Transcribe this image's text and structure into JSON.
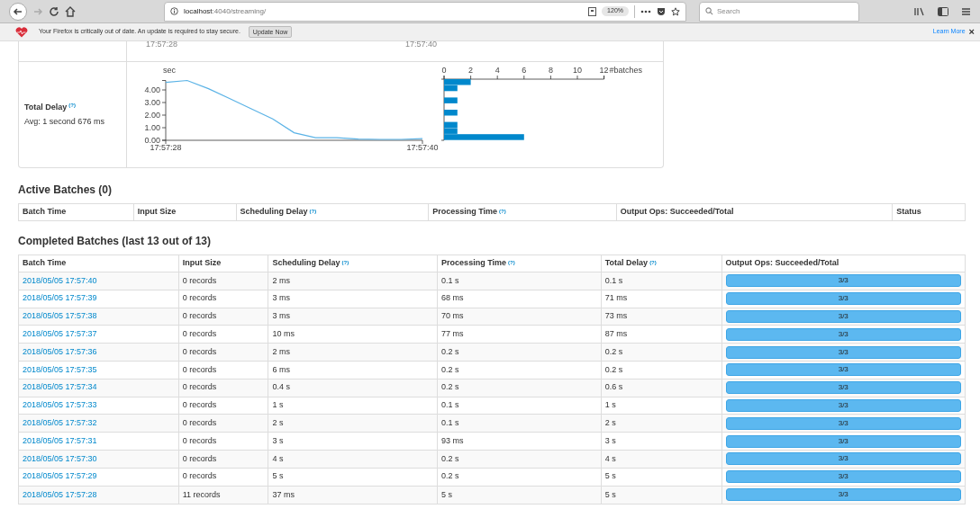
{
  "browser": {
    "url_host": "localhost",
    "url_path": ":4040/streaming/",
    "zoom": "120%",
    "search_placeholder": "Search"
  },
  "notification": {
    "message": "Your Firefox is critically out of date. An update is required to stay secure.",
    "button": "Update Now",
    "link": "Learn More",
    "close": "×"
  },
  "previous_chart_axis": [
    "17:57:28",
    "17:57:40"
  ],
  "total_delay": {
    "label": "Total Delay",
    "help": "(?)",
    "average": "Avg: 1 second 676 ms",
    "chart_data": {
      "type": "line",
      "ylabel": "sec",
      "categories": [
        "17:57:28",
        null,
        null,
        null,
        null,
        null,
        null,
        null,
        null,
        null,
        null,
        null,
        "17:57:40"
      ],
      "series": [
        {
          "color": "#5bb3e6",
          "values": [
            4.6,
            4.75,
            4.1,
            3.3,
            2.5,
            1.7,
            0.6,
            0.2,
            0.2,
            0.1,
            0.07,
            0.07,
            0.13
          ]
        }
      ],
      "yticks": [
        {
          "value": 0,
          "label": "0.00"
        },
        {
          "value": 1,
          "label": "1.00"
        },
        {
          "value": 2,
          "label": "2.00"
        },
        {
          "value": 3,
          "label": "3.00"
        },
        {
          "value": 4,
          "label": "4.00"
        }
      ],
      "ylim": [
        0,
        4.75
      ]
    },
    "histogram": {
      "chart_data": {
        "type": "bar",
        "orientation": "horizontal",
        "xlabel": "#batches",
        "series": [
          {
            "color": "#0088cc",
            "values": [
              2,
              1,
              0,
              1,
              0,
              1,
              0,
              1,
              1,
              6
            ]
          }
        ],
        "xticks": [
          0,
          2,
          4,
          6,
          8,
          10,
          12
        ],
        "xlim": [
          0,
          12
        ]
      }
    }
  },
  "active_batches": {
    "title": "Active Batches (0)",
    "columns": [
      {
        "label": "Batch Time"
      },
      {
        "label": "Input Size"
      },
      {
        "label": "Scheduling Delay",
        "help": "(?)"
      },
      {
        "label": "Processing Time",
        "help": "(?)"
      },
      {
        "label": "Output Ops: Succeeded/Total"
      },
      {
        "label": "Status"
      }
    ]
  },
  "completed_batches": {
    "title": "Completed Batches (last 13 out of 13)",
    "columns": [
      {
        "label": "Batch Time"
      },
      {
        "label": "Input Size"
      },
      {
        "label": "Scheduling Delay",
        "help": "(?)"
      },
      {
        "label": "Processing Time",
        "help": "(?)"
      },
      {
        "label": "Total Delay",
        "help": "(?)"
      },
      {
        "label": "Output Ops: Succeeded/Total"
      }
    ],
    "rows": [
      {
        "batch_time": "2018/05/05 17:57:40",
        "input_size": "0 records",
        "scheduling_delay": "2 ms",
        "processing_time": "0.1 s",
        "total_delay": "0.1 s",
        "output_ops": "3/3",
        "level": 1
      },
      {
        "batch_time": "2018/05/05 17:57:39",
        "input_size": "0 records",
        "scheduling_delay": "3 ms",
        "processing_time": "68 ms",
        "total_delay": "71 ms",
        "output_ops": "3/3",
        "level": 1
      },
      {
        "batch_time": "2018/05/05 17:57:38",
        "input_size": "0 records",
        "scheduling_delay": "3 ms",
        "processing_time": "70 ms",
        "total_delay": "73 ms",
        "output_ops": "3/3",
        "level": 1
      },
      {
        "batch_time": "2018/05/05 17:57:37",
        "input_size": "0 records",
        "scheduling_delay": "10 ms",
        "processing_time": "77 ms",
        "total_delay": "87 ms",
        "output_ops": "3/3",
        "level": 1
      },
      {
        "batch_time": "2018/05/05 17:57:36",
        "input_size": "0 records",
        "scheduling_delay": "2 ms",
        "processing_time": "0.2 s",
        "total_delay": "0.2 s",
        "output_ops": "3/3",
        "level": 1
      },
      {
        "batch_time": "2018/05/05 17:57:35",
        "input_size": "0 records",
        "scheduling_delay": "6 ms",
        "processing_time": "0.2 s",
        "total_delay": "0.2 s",
        "output_ops": "3/3",
        "level": 1
      },
      {
        "batch_time": "2018/05/05 17:57:34",
        "input_size": "0 records",
        "scheduling_delay": "0.4 s",
        "processing_time": "0.2 s",
        "total_delay": "0.6 s",
        "output_ops": "3/3",
        "level": 1
      },
      {
        "batch_time": "2018/05/05 17:57:33",
        "input_size": "0 records",
        "scheduling_delay": "1 s",
        "processing_time": "0.1 s",
        "total_delay": "1 s",
        "output_ops": "3/3",
        "level": 1
      },
      {
        "batch_time": "2018/05/05 17:57:32",
        "input_size": "0 records",
        "scheduling_delay": "2 s",
        "processing_time": "0.1 s",
        "total_delay": "2 s",
        "output_ops": "3/3",
        "level": 1
      },
      {
        "batch_time": "2018/05/05 17:57:31",
        "input_size": "0 records",
        "scheduling_delay": "3 s",
        "processing_time": "93 ms",
        "total_delay": "3 s",
        "output_ops": "3/3",
        "level": 1
      },
      {
        "batch_time": "2018/05/05 17:57:30",
        "input_size": "0 records",
        "scheduling_delay": "4 s",
        "processing_time": "0.2 s",
        "total_delay": "4 s",
        "output_ops": "3/3",
        "level": 1
      },
      {
        "batch_time": "2018/05/05 17:57:29",
        "input_size": "0 records",
        "scheduling_delay": "5 s",
        "processing_time": "0.2 s",
        "total_delay": "5 s",
        "output_ops": "3/3",
        "level": 1
      },
      {
        "batch_time": "2018/05/05 17:57:28",
        "input_size": "11 records",
        "scheduling_delay": "37 ms",
        "processing_time": "5 s",
        "total_delay": "5 s",
        "output_ops": "3/3",
        "level": 1
      }
    ]
  }
}
